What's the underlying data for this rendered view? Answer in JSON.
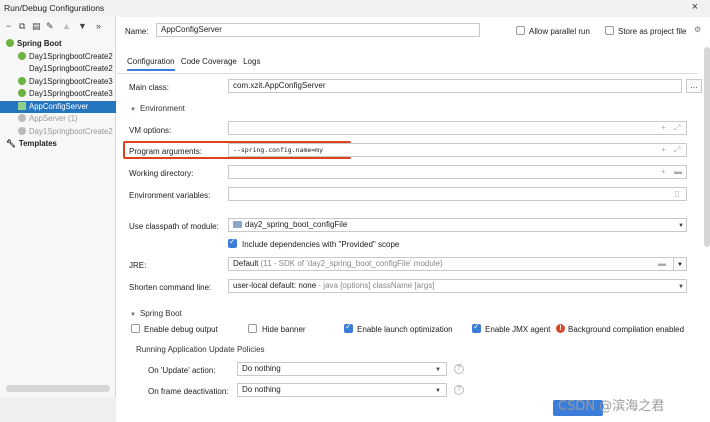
{
  "window": {
    "title": "Run/Debug Configurations",
    "close": "×"
  },
  "toolbar": {
    "icons": [
      "minus",
      "copy",
      "save",
      "wrench",
      "up",
      "down",
      "expand"
    ]
  },
  "tree": {
    "group": "Spring Boot",
    "items": [
      "Day1SpringbootCreate2",
      "Day1SpringbootCreate2",
      "Day1SpringbootCreate3",
      "Day1SpringbootCreate3",
      "AppConfigServer",
      "AppServer (1)",
      "Day1SpringbootCreate2"
    ],
    "templates": "Templates"
  },
  "name": {
    "label": "Name:",
    "value": "AppConfigServer"
  },
  "allow_parallel": "Allow parallel run",
  "store_as_file": "Store as project file",
  "tabs": [
    "Configuration",
    "Code Coverage",
    "Logs"
  ],
  "main_class": {
    "label": "Main class:",
    "value": "com.xzit.AppConfigServer"
  },
  "environment": {
    "header": "Environment",
    "vm_options": "VM options:",
    "program_arguments": {
      "label": "Program arguments:",
      "value": "--spring.config.name=my"
    },
    "working_directory": "Working directory:",
    "environment_variables": "Environment variables:"
  },
  "classpath": {
    "label": "Use classpath of module:",
    "value": "day2_spring_boot_configFile"
  },
  "include_provided": "Include dependencies with \"Provided\" scope",
  "jre": {
    "label": "JRE:",
    "value": "Default",
    "hint": "(11 - SDK of 'day2_spring_boot_configFile' module)"
  },
  "shorten": {
    "label": "Shorten command line:",
    "value": "user-local default: none",
    "hint": "- java [options] className [args]"
  },
  "spring_boot": {
    "header": "Spring Boot",
    "debug_output": "Enable debug output",
    "hide_banner": "Hide banner",
    "launch_optimization": "Enable launch optimization",
    "jmx_agent": "Enable JMX agent",
    "background_compilation": "Background compilation enabled"
  },
  "update_policies": {
    "header": "Running Application Update Policies",
    "on_update": {
      "label": "On 'Update' action:",
      "value": "Do nothing"
    },
    "on_frame": {
      "label": "On frame deactivation:",
      "value": "Do nothing"
    }
  },
  "watermark": "CSDN @滨海之君",
  "colors": {
    "accent": "#3b7dd8",
    "selection": "#2675bf",
    "highlight": "#e0421e"
  }
}
